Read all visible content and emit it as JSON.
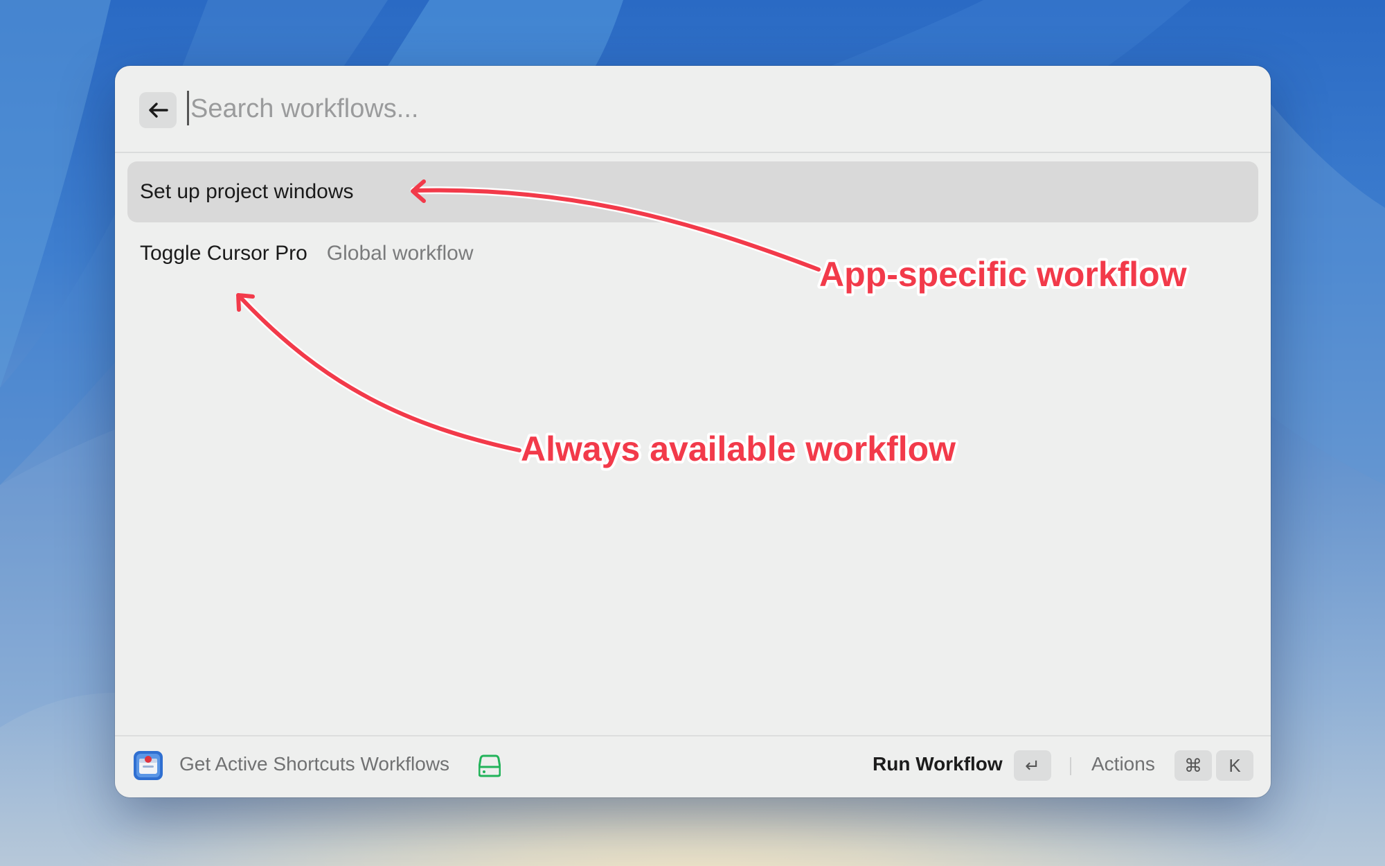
{
  "search": {
    "placeholder": "Search workflows..."
  },
  "items": [
    {
      "title": "Set up project windows",
      "subtitle": "",
      "selected": true
    },
    {
      "title": "Toggle Cursor Pro",
      "subtitle": "Global workflow",
      "selected": false
    }
  ],
  "footer": {
    "command_title": "Get Active Shortcuts Workflows",
    "primary_action": "Run Workflow",
    "primary_key": "↵",
    "actions_label": "Actions",
    "actions_keys": [
      "⌘",
      "K"
    ]
  },
  "annotations": {
    "app_specific": "App-specific workflow",
    "always_available": "Always available workflow"
  },
  "colors": {
    "annotation": "#f23a4a",
    "window_bg": "#eeefee",
    "selected_row": "#d9d9d9",
    "drive_icon": "#22b35a"
  },
  "icons": {
    "back": "arrow-left-icon",
    "app": "shortcuts-app-icon",
    "drive": "drive-icon"
  }
}
